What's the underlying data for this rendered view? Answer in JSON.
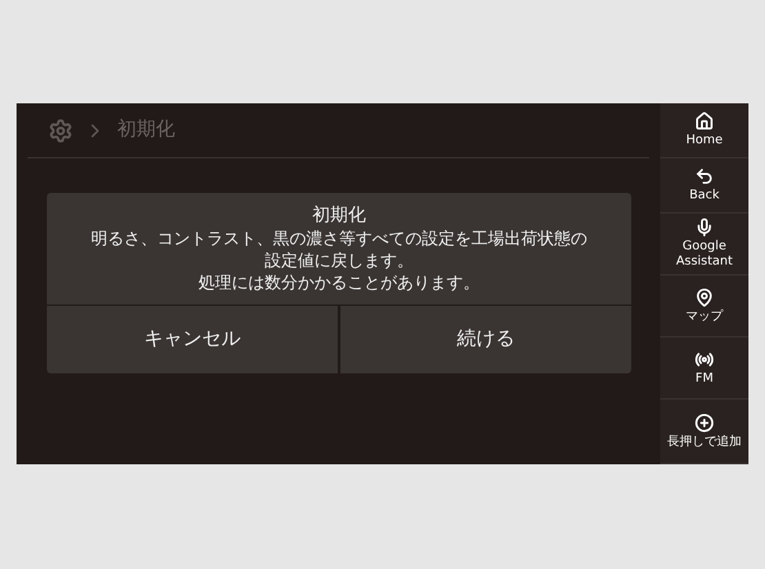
{
  "header": {
    "breadcrumb": "初期化"
  },
  "dialog": {
    "title": "初期化",
    "message_lines": [
      "明るさ、コントラスト、黒の濃さ等すべての設定を工場出荷状態の",
      "設定値に戻します。",
      "処理には数分かかることがあります。"
    ],
    "buttons": [
      "キャンセル",
      "続ける"
    ]
  },
  "sidebar": {
    "items": [
      {
        "kind": "home",
        "label": "Home"
      },
      {
        "kind": "back",
        "label": "Back"
      },
      {
        "kind": "assistant",
        "label": "Google Assistant"
      },
      {
        "kind": "map",
        "label": "マップ"
      },
      {
        "kind": "radio",
        "label": "FM"
      },
      {
        "kind": "add",
        "label": "長押しで追加"
      }
    ]
  }
}
